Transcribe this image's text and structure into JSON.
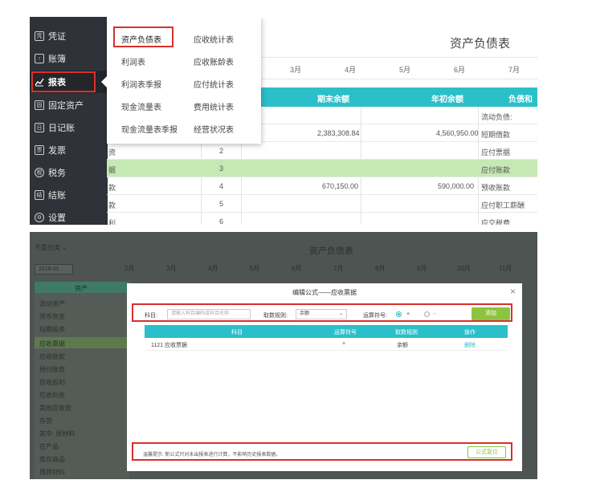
{
  "top": {
    "sidebar": {
      "items": [
        {
          "label": "凭证",
          "icon": "voucher-icon"
        },
        {
          "label": "账簿",
          "icon": "ledger-icon"
        },
        {
          "label": "报表",
          "icon": "chart-icon"
        },
        {
          "label": "固定资产",
          "icon": "asset-icon"
        },
        {
          "label": "日记账",
          "icon": "journal-icon"
        },
        {
          "label": "发票",
          "icon": "invoice-icon"
        },
        {
          "label": "税务",
          "icon": "tax-icon"
        },
        {
          "label": "结账",
          "icon": "close-books-icon"
        },
        {
          "label": "设置",
          "icon": "gear-icon"
        }
      ]
    },
    "menu": {
      "col1": [
        "资产负债表",
        "利润表",
        "利润表季报",
        "现金流量表",
        "现金流量表季报"
      ],
      "col2": [
        "应收统计表",
        "应收账龄表",
        "应付统计表",
        "费用统计表",
        "经营状况表"
      ]
    },
    "title": "资产负债表",
    "months": [
      "3月",
      "4月",
      "5月",
      "6月",
      "7月"
    ],
    "table_headers": [
      "期末余额",
      "年初余额",
      "负债和所"
    ],
    "rows": [
      {
        "label": "",
        "num": "",
        "end": "",
        "begin": "",
        "right": "流动负债:"
      },
      {
        "label": "",
        "num": "",
        "end": "2,383,308.84",
        "begin": "4,560,950.00",
        "right": "短期借款"
      },
      {
        "label": "资",
        "num": "2",
        "end": "",
        "begin": "",
        "right": "应付票据"
      },
      {
        "label": "据",
        "num": "3",
        "end": "",
        "begin": "",
        "right": "应付账款"
      },
      {
        "label": "款",
        "num": "4",
        "end": "670,150.00",
        "begin": "590,000.00",
        "right": "预收账款"
      },
      {
        "label": "款",
        "num": "5",
        "end": "",
        "begin": "",
        "right": "应付职工薪酬"
      },
      {
        "label": "利",
        "num": "6",
        "end": "",
        "begin": "",
        "right": "应交税费"
      }
    ]
  },
  "bottom": {
    "bg_title": "资产负债表",
    "bg_toolbar": "不重分类",
    "bg_date": "2018-01",
    "bg_months": [
      "2月",
      "3月",
      "4月",
      "5月",
      "6月",
      "7月",
      "8月",
      "9月",
      "10月",
      "11月"
    ],
    "bg_left_header": "资产",
    "bg_left_items": [
      "流动资产:",
      "货币资金",
      "短期投资",
      "应收票据",
      "应收账款",
      "预付账款",
      "应收股利",
      "应收利息",
      "其他应收款",
      "存货",
      "其中: 原材料",
      "在产品",
      "库存商品",
      "周转材料"
    ],
    "modal": {
      "title": "编辑公式——应收票据",
      "close": "×",
      "subject_label": "科目:",
      "subject_placeholder": "请输入科目编码或科目名称",
      "rule_label": "取数规则:",
      "rule_value": "余额",
      "operator_label": "运算符号:",
      "op_plus": "+",
      "op_minus": "-",
      "add_button": "添加",
      "headers": [
        "科目",
        "运算符号",
        "取数规则",
        "操作"
      ],
      "row": {
        "subject": "1121 应收票据",
        "operator": "+",
        "rule": "余额",
        "action": "删除"
      },
      "footer_tip": "温馨提示: 新公式只对未出报表进行计算，不影响历史报表数据。",
      "footer_button": "公式复位"
    }
  },
  "colors": {
    "accent_teal": "#2bbfc9",
    "highlight_green": "#c6e8b3",
    "add_green": "#8dc43f",
    "red_box": "#d9302c",
    "sidebar": "#2f3238"
  }
}
